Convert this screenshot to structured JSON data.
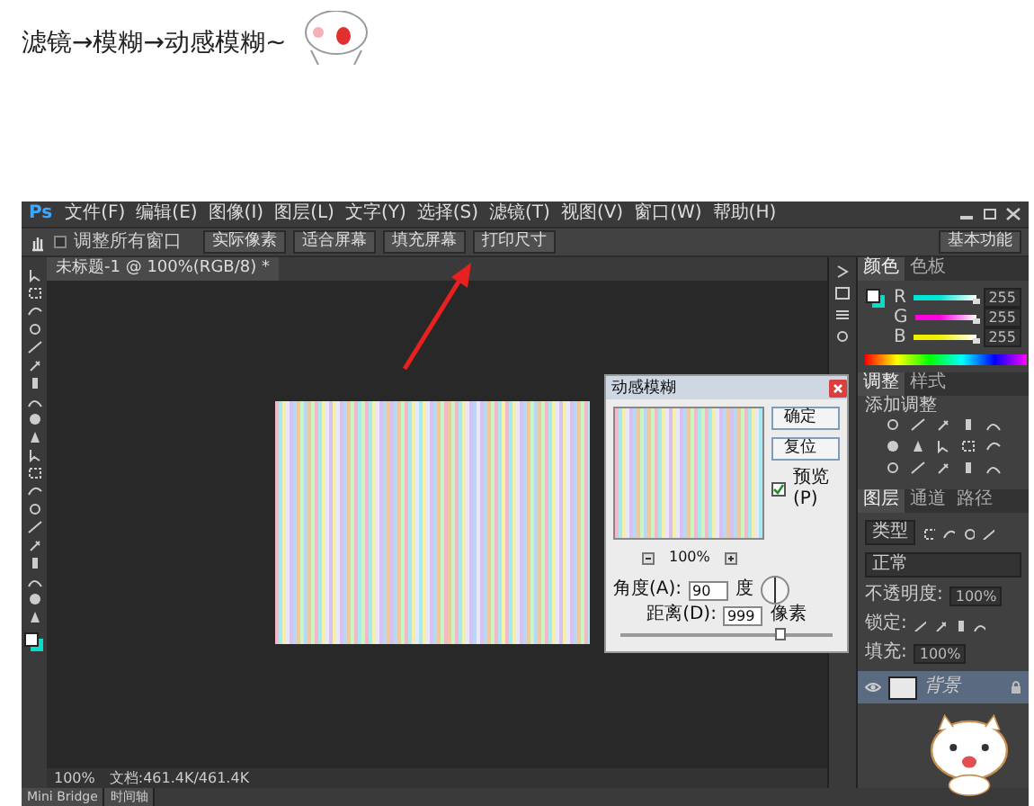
{
  "post_text": "滤镜→模糊→动感模糊~",
  "photoshop": {
    "logo": "Ps",
    "menu": [
      "文件(F)",
      "编辑(E)",
      "图像(I)",
      "图层(L)",
      "文字(Y)",
      "选择(S)",
      "滤镜(T)",
      "视图(V)",
      "窗口(W)",
      "帮助(H)"
    ],
    "options_bar": {
      "checkbox": {
        "label": "调整所有窗口",
        "checked": false
      },
      "buttons": [
        "实际像素",
        "适合屏幕",
        "填充屏幕",
        "打印尺寸"
      ],
      "workspace": "基本功能"
    },
    "document_tab": "未标题-1 @ 100%(RGB/8) *",
    "dialog": {
      "title": "动感模糊",
      "ok": "确定",
      "reset": "复位",
      "preview": {
        "label": "预览(P)",
        "checked": true
      },
      "zoom": "100%",
      "angle": {
        "label": "角度(A):",
        "value": "90",
        "unit": "度"
      },
      "distance": {
        "label": "距离(D):",
        "value": "999",
        "unit": "像素",
        "level": 0.75
      }
    },
    "color_panel": {
      "tabs": [
        {
          "label": "颜色",
          "selected": true
        },
        {
          "label": "色板",
          "selected": false
        }
      ],
      "channels": [
        {
          "name": "R",
          "value": "255",
          "color": "#00e5d5",
          "level": 1
        },
        {
          "name": "G",
          "value": "255",
          "color": "#ff00e0",
          "level": 1
        },
        {
          "name": "B",
          "value": "255",
          "color": "#f0f000",
          "level": 1
        }
      ]
    },
    "adjustments_panel": {
      "tabs": [
        {
          "label": "调整",
          "selected": true
        },
        {
          "label": "样式",
          "selected": false
        }
      ],
      "hint": "添加调整"
    },
    "layers_panel": {
      "tabs": [
        {
          "label": "图层",
          "selected": true
        },
        {
          "label": "通道",
          "selected": false
        },
        {
          "label": "路径",
          "selected": false
        }
      ],
      "filter": "类型",
      "blend_mode": "正常",
      "opacity_label": "不透明度:",
      "opacity": "100%",
      "lock_label": "锁定:",
      "fill_label": "填充:",
      "fill": "100%",
      "layers": [
        {
          "name": "背景",
          "selected": true
        }
      ]
    },
    "status": {
      "zoom": "100%",
      "document": "文档:461.4K/461.4K"
    },
    "bottom_tabs": [
      "Mini Bridge",
      "时间轴"
    ]
  }
}
